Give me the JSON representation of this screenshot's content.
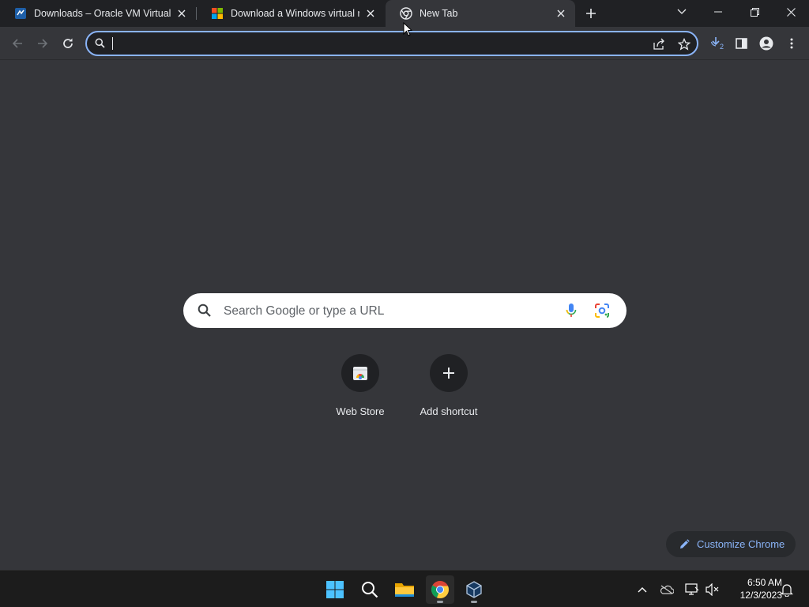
{
  "tabs": [
    {
      "title": "Downloads – Oracle VM VirtualBox",
      "favicon": "virtualbox-icon",
      "active": false
    },
    {
      "title": "Download a Windows virtual machine",
      "favicon": "microsoft-icon",
      "active": false
    },
    {
      "title": "New Tab",
      "favicon": "chrome-icon",
      "active": true
    }
  ],
  "omnibox": {
    "value": "",
    "placeholder": ""
  },
  "toolbar": {
    "downloads_badge": "2"
  },
  "ntp": {
    "search_placeholder": "Search Google or type a URL",
    "shortcuts": [
      {
        "label": "Web Store",
        "icon": "web-store-icon"
      },
      {
        "label": "Add shortcut",
        "icon": "plus-icon"
      }
    ],
    "customize_label": "Customize Chrome"
  },
  "taskbar": {
    "apps": [
      "windows-start-icon",
      "search-icon",
      "file-explorer-icon",
      "chrome-icon",
      "virtualbox-icon"
    ],
    "time": "6:50 AM",
    "date": "12/3/2023"
  },
  "colors": {
    "accent": "#8ab4f8",
    "background": "#35363a",
    "tabstrip": "#202124"
  }
}
